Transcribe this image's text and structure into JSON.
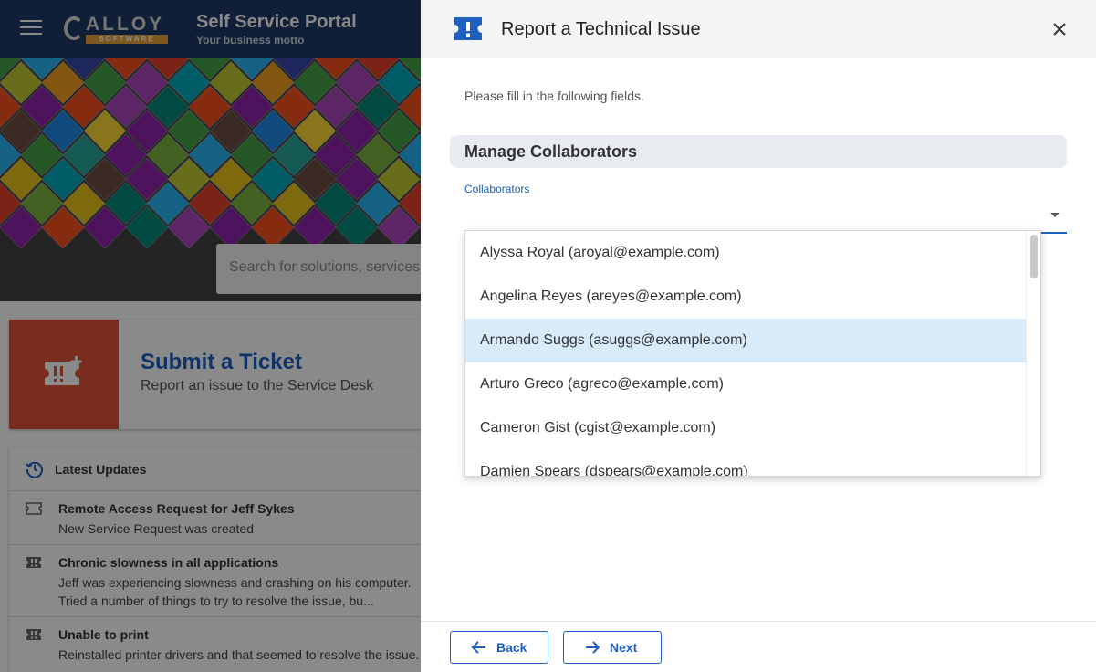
{
  "portal": {
    "title": "Self Service Portal",
    "motto": "Your business motto",
    "logo_word": "ALLOY",
    "logo_sub": "SOFTWARE",
    "search_placeholder": "Search for solutions, services",
    "submit_card": {
      "title": "Submit a Ticket",
      "subtitle": "Report an issue to the Service Desk",
      "icon": "ticket-icon",
      "color": "#e05438"
    },
    "updates": {
      "title": "Latest Updates",
      "items": [
        {
          "title": "Remote Access Request for Jeff Sykes",
          "text": "New Service Request was created",
          "icon": "ticket-icon"
        },
        {
          "title": "Chronic slowness in all applications",
          "text": "Jeff was experiencing slowness and crashing on his computer.",
          "text2": "Tried a number of things to try to resolve the issue, bu...",
          "icon": "ticket-icon"
        },
        {
          "title": "Unable to print",
          "text": "Reinstalled printer drivers and that seemed to resolve the issue.",
          "icon": "ticket-icon"
        }
      ]
    }
  },
  "panel": {
    "title": "Report a Technical Issue",
    "icon": "alert-ticket-icon",
    "instructions": "Please fill in the following fields.",
    "section_title": "Manage Collaborators",
    "collaborators_label": "Collaborators",
    "dropdown_options": [
      "Alyssa Royal (aroyal@example.com)",
      "Angelina Reyes (areyes@example.com)",
      "Armando Suggs (asuggs@example.com)",
      "Arturo Greco (agreco@example.com)",
      "Cameron Gist (cgist@example.com)",
      "Damien Spears (dspears@example.com)"
    ],
    "highlighted_option": "Armando Suggs (asuggs@example.com)",
    "back_label": "Back",
    "next_label": "Next"
  },
  "colors": {
    "accent": "#1f5fbf",
    "header": "#1e3a66",
    "highlight": "#d8ebfb"
  }
}
